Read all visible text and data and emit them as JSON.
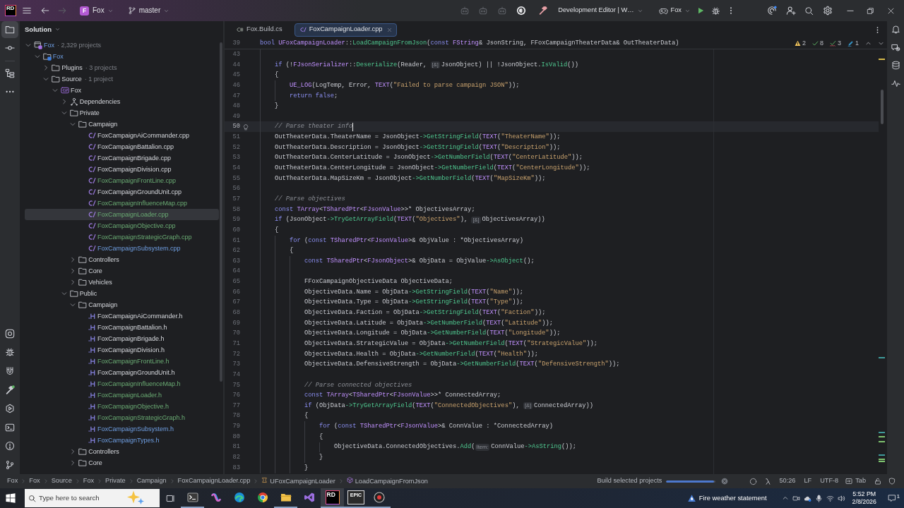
{
  "title_bar": {
    "logo": "RD",
    "project": {
      "initial": "F",
      "name": "Fox"
    },
    "branch": "master",
    "run_configuration": "Development Editor | W…",
    "target": "Fox",
    "history": {
      "back_disabled": false,
      "forward_disabled": true
    }
  },
  "tool_strip": {
    "top": [
      {
        "kind": "project",
        "selected": true
      },
      {
        "kind": "commit",
        "selected": false
      },
      {
        "kind": "structure",
        "selected": false
      },
      {
        "kind": "more",
        "selected": false
      }
    ],
    "bottom": [
      {
        "kind": "record",
        "selected": false
      },
      {
        "kind": "debug",
        "selected": false
      },
      {
        "kind": "magnet",
        "selected": false
      },
      {
        "kind": "build",
        "selected": false
      },
      {
        "kind": "run",
        "selected": false
      },
      {
        "kind": "terminal",
        "selected": false
      },
      {
        "kind": "problems",
        "selected": false
      },
      {
        "kind": "git",
        "selected": false
      }
    ]
  },
  "solution_panel": {
    "title": "Solution",
    "tree": [
      {
        "kind": "solution",
        "label": "Fox",
        "note": "· 2,329 projects",
        "added": false,
        "modified": true,
        "expanded": true,
        "selected": false,
        "children": [
          {
            "kind": "project",
            "label": "Fox",
            "added": false,
            "modified": true,
            "expanded": true,
            "selected": false,
            "children": [
              {
                "kind": "folder",
                "label": "Plugins",
                "note": "· 3 projects",
                "added": false,
                "modified": false,
                "expanded": false,
                "selected": false
              },
              {
                "kind": "folder",
                "label": "Source",
                "note": "· 1 project",
                "added": false,
                "modified": false,
                "expanded": true,
                "selected": false,
                "children": [
                  {
                    "kind": "module",
                    "label": "Fox",
                    "added": false,
                    "modified": false,
                    "expanded": true,
                    "selected": false,
                    "children": [
                      {
                        "kind": "dependencies",
                        "label": "Dependencies",
                        "added": false,
                        "modified": false,
                        "expanded": false,
                        "selected": false
                      },
                      {
                        "kind": "folder",
                        "label": "Private",
                        "added": false,
                        "modified": false,
                        "expanded": true,
                        "selected": false,
                        "children": [
                          {
                            "kind": "folder",
                            "label": "Campaign",
                            "added": false,
                            "modified": false,
                            "expanded": true,
                            "selected": false,
                            "children": [
                              {
                                "kind": "cpp-file",
                                "label": "FoxCampaignAiCommander.cpp",
                                "added": false,
                                "modified": false,
                                "selected": false
                              },
                              {
                                "kind": "cpp-file",
                                "label": "FoxCampaignBattalion.cpp",
                                "added": false,
                                "modified": false,
                                "selected": false
                              },
                              {
                                "kind": "cpp-file",
                                "label": "FoxCampaignBrigade.cpp",
                                "added": false,
                                "modified": false,
                                "selected": false
                              },
                              {
                                "kind": "cpp-file",
                                "label": "FoxCampaignDivision.cpp",
                                "added": false,
                                "modified": false,
                                "selected": false
                              },
                              {
                                "kind": "cpp-file",
                                "label": "FoxCampaignFrontLine.cpp",
                                "added": true,
                                "modified": false,
                                "selected": false
                              },
                              {
                                "kind": "cpp-file",
                                "label": "FoxCampaignGroundUnit.cpp",
                                "added": false,
                                "modified": false,
                                "selected": false
                              },
                              {
                                "kind": "cpp-file",
                                "label": "FoxCampaignInfluenceMap.cpp",
                                "added": true,
                                "modified": false,
                                "selected": false
                              },
                              {
                                "kind": "cpp-file",
                                "label": "FoxCampaignLoader.cpp",
                                "added": true,
                                "modified": false,
                                "selected": true
                              },
                              {
                                "kind": "cpp-file",
                                "label": "FoxCampaignObjective.cpp",
                                "added": true,
                                "modified": false,
                                "selected": false
                              },
                              {
                                "kind": "cpp-file",
                                "label": "FoxCampaignStrategicGraph.cpp",
                                "added": true,
                                "modified": false,
                                "selected": false
                              },
                              {
                                "kind": "cpp-file",
                                "label": "FoxCampaignSubsystem.cpp",
                                "added": false,
                                "modified": true,
                                "selected": false
                              }
                            ]
                          },
                          {
                            "kind": "folder",
                            "label": "Controllers",
                            "added": false,
                            "modified": false,
                            "expanded": false,
                            "selected": false
                          },
                          {
                            "kind": "folder",
                            "label": "Core",
                            "added": false,
                            "modified": false,
                            "expanded": false,
                            "selected": false
                          },
                          {
                            "kind": "folder",
                            "label": "Vehicles",
                            "added": false,
                            "modified": false,
                            "expanded": false,
                            "selected": false
                          }
                        ]
                      },
                      {
                        "kind": "folder",
                        "label": "Public",
                        "added": false,
                        "modified": false,
                        "expanded": true,
                        "selected": false,
                        "children": [
                          {
                            "kind": "folder",
                            "label": "Campaign",
                            "added": false,
                            "modified": false,
                            "expanded": true,
                            "selected": false,
                            "children": [
                              {
                                "kind": "header-file",
                                "label": "FoxCampaignAiCommander.h",
                                "added": false,
                                "modified": false,
                                "selected": false
                              },
                              {
                                "kind": "header-file",
                                "label": "FoxCampaignBattalion.h",
                                "added": false,
                                "modified": false,
                                "selected": false
                              },
                              {
                                "kind": "header-file",
                                "label": "FoxCampaignBrigade.h",
                                "added": false,
                                "modified": false,
                                "selected": false
                              },
                              {
                                "kind": "header-file",
                                "label": "FoxCampaignDivision.h",
                                "added": false,
                                "modified": false,
                                "selected": false
                              },
                              {
                                "kind": "header-file",
                                "label": "FoxCampaignFrontLine.h",
                                "added": true,
                                "modified": false,
                                "selected": false
                              },
                              {
                                "kind": "header-file",
                                "label": "FoxCampaignGroundUnit.h",
                                "added": false,
                                "modified": false,
                                "selected": false
                              },
                              {
                                "kind": "header-file",
                                "label": "FoxCampaignInfluenceMap.h",
                                "added": true,
                                "modified": false,
                                "selected": false
                              },
                              {
                                "kind": "header-file",
                                "label": "FoxCampaignLoader.h",
                                "added": true,
                                "modified": false,
                                "selected": false
                              },
                              {
                                "kind": "header-file",
                                "label": "FoxCampaignObjective.h",
                                "added": true,
                                "modified": false,
                                "selected": false
                              },
                              {
                                "kind": "header-file",
                                "label": "FoxCampaignStrategicGraph.h",
                                "added": true,
                                "modified": false,
                                "selected": false
                              },
                              {
                                "kind": "header-file",
                                "label": "FoxCampaignSubsystem.h",
                                "added": false,
                                "modified": true,
                                "selected": false
                              },
                              {
                                "kind": "header-file",
                                "label": "FoxCampaignTypes.h",
                                "added": false,
                                "modified": true,
                                "selected": false
                              }
                            ]
                          },
                          {
                            "kind": "folder",
                            "label": "Controllers",
                            "added": false,
                            "modified": false,
                            "expanded": false,
                            "selected": false
                          },
                          {
                            "kind": "folder",
                            "label": "Core",
                            "added": false,
                            "modified": false,
                            "expanded": false,
                            "selected": false
                          }
                        ]
                      }
                    ]
                  }
                ]
              }
            ]
          }
        ]
      }
    ]
  },
  "editor": {
    "tabs": [
      {
        "kind": "csharp",
        "label": "Fox.Build.cs",
        "selected": false
      },
      {
        "kind": "cpp",
        "label": "FoxCampaignLoader.cpp",
        "selected": true
      }
    ],
    "inspections": [
      {
        "kind": "warning",
        "count": "2"
      },
      {
        "kind": "check",
        "count": "8"
      },
      {
        "kind": "typo",
        "count": "3"
      },
      {
        "kind": "pencil",
        "count": "1"
      }
    ],
    "sticky_line": {
      "number": "39",
      "tokens": [
        {
          "kind": "keyword",
          "text": "bool "
        },
        {
          "kind": "type",
          "text": "UFoxCampaignLoader"
        },
        {
          "kind": "plain",
          "text": "::"
        },
        {
          "kind": "function",
          "text": "LoadCampaignFromJson"
        },
        {
          "kind": "plain",
          "text": "("
        },
        {
          "kind": "keyword",
          "text": "const "
        },
        {
          "kind": "type",
          "text": "FString"
        },
        {
          "kind": "plain",
          "text": "& JsonString, FFoxCampaignTheaterData& OutTheaterData)"
        }
      ]
    },
    "lines": [
      {
        "number": "43",
        "current": false
      },
      {
        "number": "44",
        "current": false,
        "tokens": [
          {
            "kind": "keyword",
            "text": "    if"
          },
          {
            "kind": "plain",
            "text": " (!"
          },
          {
            "kind": "type",
            "text": "FJsonSerializer"
          },
          {
            "kind": "plain",
            "text": "::"
          },
          {
            "kind": "function",
            "text": "Deserialize"
          },
          {
            "kind": "plain",
            "text": "(Reader, "
          },
          {
            "kind": "hint",
            "text": "[&]"
          },
          {
            "kind": "plain",
            "text": "JsonObject) || !JsonObject."
          },
          {
            "kind": "function",
            "text": "IsValid"
          },
          {
            "kind": "plain",
            "text": "())"
          }
        ]
      },
      {
        "number": "45",
        "current": false,
        "tokens": [
          {
            "kind": "plain",
            "text": "    {"
          }
        ]
      },
      {
        "number": "46",
        "current": false,
        "tokens": [
          {
            "kind": "type",
            "text": "        UE_LOG"
          },
          {
            "kind": "plain",
            "text": "(LogTemp, Error, "
          },
          {
            "kind": "type",
            "text": "TEXT"
          },
          {
            "kind": "plain",
            "text": "("
          },
          {
            "kind": "string",
            "text": "\"Failed to parse campaign JSON\""
          },
          {
            "kind": "plain",
            "text": "));"
          }
        ]
      },
      {
        "number": "47",
        "current": false,
        "tokens": [
          {
            "kind": "keyword",
            "text": "        return false"
          },
          {
            "kind": "plain",
            "text": ";"
          }
        ]
      },
      {
        "number": "48",
        "current": false,
        "tokens": [
          {
            "kind": "plain",
            "text": "    }"
          }
        ]
      },
      {
        "number": "49",
        "current": false
      },
      {
        "number": "50",
        "current": true,
        "tokens": [
          {
            "kind": "comment",
            "text": "    // Parse theater info"
          }
        ]
      },
      {
        "number": "51",
        "current": false,
        "tokens": [
          {
            "kind": "plain",
            "text": "    OutTheaterData.TheaterName = JsonObject"
          },
          {
            "kind": "function",
            "text": "->GetStringField"
          },
          {
            "kind": "plain",
            "text": "("
          },
          {
            "kind": "type",
            "text": "TEXT"
          },
          {
            "kind": "plain",
            "text": "("
          },
          {
            "kind": "string",
            "text": "\"TheaterName\""
          },
          {
            "kind": "plain",
            "text": "));"
          }
        ]
      },
      {
        "number": "52",
        "current": false,
        "tokens": [
          {
            "kind": "plain",
            "text": "    OutTheaterData.Description = JsonObject"
          },
          {
            "kind": "function",
            "text": "->GetStringField"
          },
          {
            "kind": "plain",
            "text": "("
          },
          {
            "kind": "type",
            "text": "TEXT"
          },
          {
            "kind": "plain",
            "text": "("
          },
          {
            "kind": "string",
            "text": "\"Description\""
          },
          {
            "kind": "plain",
            "text": "));"
          }
        ]
      },
      {
        "number": "53",
        "current": false,
        "tokens": [
          {
            "kind": "plain",
            "text": "    OutTheaterData.CenterLatitude = JsonObject"
          },
          {
            "kind": "function",
            "text": "->GetNumberField"
          },
          {
            "kind": "plain",
            "text": "("
          },
          {
            "kind": "type",
            "text": "TEXT"
          },
          {
            "kind": "plain",
            "text": "("
          },
          {
            "kind": "string",
            "text": "\"CenterLatitude\""
          },
          {
            "kind": "plain",
            "text": "));"
          }
        ]
      },
      {
        "number": "54",
        "current": false,
        "tokens": [
          {
            "kind": "plain",
            "text": "    OutTheaterData.CenterLongitude = JsonObject"
          },
          {
            "kind": "function",
            "text": "->GetNumberField"
          },
          {
            "kind": "plain",
            "text": "("
          },
          {
            "kind": "type",
            "text": "TEXT"
          },
          {
            "kind": "plain",
            "text": "("
          },
          {
            "kind": "string",
            "text": "\"CenterLongitude\""
          },
          {
            "kind": "plain",
            "text": "));"
          }
        ]
      },
      {
        "number": "55",
        "current": false,
        "tokens": [
          {
            "kind": "plain",
            "text": "    OutTheaterData.MapSizeKm = JsonObject"
          },
          {
            "kind": "function",
            "text": "->GetNumberField"
          },
          {
            "kind": "plain",
            "text": "("
          },
          {
            "kind": "type",
            "text": "TEXT"
          },
          {
            "kind": "plain",
            "text": "("
          },
          {
            "kind": "string",
            "text": "\"MapSizeKm\""
          },
          {
            "kind": "plain",
            "text": "));"
          }
        ]
      },
      {
        "number": "56",
        "current": false
      },
      {
        "number": "57",
        "current": false,
        "tokens": [
          {
            "kind": "comment",
            "text": "    // Parse objectives"
          }
        ]
      },
      {
        "number": "58",
        "current": false,
        "tokens": [
          {
            "kind": "keyword",
            "text": "    const "
          },
          {
            "kind": "type",
            "text": "TArray"
          },
          {
            "kind": "plain",
            "text": "<"
          },
          {
            "kind": "type",
            "text": "TSharedPtr"
          },
          {
            "kind": "plain",
            "text": "<"
          },
          {
            "kind": "type",
            "text": "FJsonValue"
          },
          {
            "kind": "plain",
            "text": ">>* ObjectivesArray;"
          }
        ]
      },
      {
        "number": "59",
        "current": false,
        "tokens": [
          {
            "kind": "keyword",
            "text": "    if"
          },
          {
            "kind": "plain",
            "text": " (JsonObject"
          },
          {
            "kind": "function",
            "text": "->TryGetArrayField"
          },
          {
            "kind": "plain",
            "text": "("
          },
          {
            "kind": "type",
            "text": "TEXT"
          },
          {
            "kind": "plain",
            "text": "("
          },
          {
            "kind": "string",
            "text": "\"Objectives\""
          },
          {
            "kind": "plain",
            "text": "), "
          },
          {
            "kind": "hint",
            "text": "[&]"
          },
          {
            "kind": "plain",
            "text": "ObjectivesArray))"
          }
        ]
      },
      {
        "number": "60",
        "current": false,
        "tokens": [
          {
            "kind": "plain",
            "text": "    {"
          }
        ]
      },
      {
        "number": "61",
        "current": false,
        "tokens": [
          {
            "kind": "keyword",
            "text": "        for"
          },
          {
            "kind": "plain",
            "text": " ("
          },
          {
            "kind": "keyword",
            "text": "const "
          },
          {
            "kind": "type",
            "text": "TSharedPtr"
          },
          {
            "kind": "plain",
            "text": "<"
          },
          {
            "kind": "type",
            "text": "FJsonValue"
          },
          {
            "kind": "plain",
            "text": ">& ObjValue : *ObjectivesArray)"
          }
        ]
      },
      {
        "number": "62",
        "current": false,
        "tokens": [
          {
            "kind": "plain",
            "text": "        {"
          }
        ]
      },
      {
        "number": "63",
        "current": false,
        "tokens": [
          {
            "kind": "keyword",
            "text": "            const "
          },
          {
            "kind": "type",
            "text": "TSharedPtr"
          },
          {
            "kind": "plain",
            "text": "<"
          },
          {
            "kind": "type",
            "text": "FJsonObject"
          },
          {
            "kind": "plain",
            "text": ">& ObjData = ObjValue"
          },
          {
            "kind": "function",
            "text": "->AsObject"
          },
          {
            "kind": "plain",
            "text": "();"
          }
        ]
      },
      {
        "number": "64",
        "current": false
      },
      {
        "number": "65",
        "current": false,
        "tokens": [
          {
            "kind": "plain",
            "text": "            FFoxCampaignObjectiveData ObjectiveData;"
          }
        ]
      },
      {
        "number": "66",
        "current": false,
        "tokens": [
          {
            "kind": "plain",
            "text": "            ObjectiveData.Name = ObjData"
          },
          {
            "kind": "function",
            "text": "->GetStringField"
          },
          {
            "kind": "plain",
            "text": "("
          },
          {
            "kind": "type",
            "text": "TEXT"
          },
          {
            "kind": "plain",
            "text": "("
          },
          {
            "kind": "string",
            "text": "\"Name\""
          },
          {
            "kind": "plain",
            "text": "));"
          }
        ]
      },
      {
        "number": "67",
        "current": false,
        "tokens": [
          {
            "kind": "plain",
            "text": "            ObjectiveData.Type = ObjData"
          },
          {
            "kind": "function",
            "text": "->GetStringField"
          },
          {
            "kind": "plain",
            "text": "("
          },
          {
            "kind": "type",
            "text": "TEXT"
          },
          {
            "kind": "plain",
            "text": "("
          },
          {
            "kind": "string",
            "text": "\"Type\""
          },
          {
            "kind": "plain",
            "text": "));"
          }
        ]
      },
      {
        "number": "68",
        "current": false,
        "tokens": [
          {
            "kind": "plain",
            "text": "            ObjectiveData.Faction = ObjData"
          },
          {
            "kind": "function",
            "text": "->GetStringField"
          },
          {
            "kind": "plain",
            "text": "("
          },
          {
            "kind": "type",
            "text": "TEXT"
          },
          {
            "kind": "plain",
            "text": "("
          },
          {
            "kind": "string",
            "text": "\"Faction\""
          },
          {
            "kind": "plain",
            "text": "));"
          }
        ]
      },
      {
        "number": "69",
        "current": false,
        "tokens": [
          {
            "kind": "plain",
            "text": "            ObjectiveData.Latitude = ObjData"
          },
          {
            "kind": "function",
            "text": "->GetNumberField"
          },
          {
            "kind": "plain",
            "text": "("
          },
          {
            "kind": "type",
            "text": "TEXT"
          },
          {
            "kind": "plain",
            "text": "("
          },
          {
            "kind": "string",
            "text": "\"Latitude\""
          },
          {
            "kind": "plain",
            "text": "));"
          }
        ]
      },
      {
        "number": "70",
        "current": false,
        "tokens": [
          {
            "kind": "plain",
            "text": "            ObjectiveData.Longitude = ObjData"
          },
          {
            "kind": "function",
            "text": "->GetNumberField"
          },
          {
            "kind": "plain",
            "text": "("
          },
          {
            "kind": "type",
            "text": "TEXT"
          },
          {
            "kind": "plain",
            "text": "("
          },
          {
            "kind": "string",
            "text": "\"Longitude\""
          },
          {
            "kind": "plain",
            "text": "));"
          }
        ]
      },
      {
        "number": "71",
        "current": false,
        "tokens": [
          {
            "kind": "plain",
            "text": "            ObjectiveData.StrategicValue = ObjData"
          },
          {
            "kind": "function",
            "text": "->GetNumberField"
          },
          {
            "kind": "plain",
            "text": "("
          },
          {
            "kind": "type",
            "text": "TEXT"
          },
          {
            "kind": "plain",
            "text": "("
          },
          {
            "kind": "string",
            "text": "\"StrategicValue\""
          },
          {
            "kind": "plain",
            "text": "));"
          }
        ]
      },
      {
        "number": "72",
        "current": false,
        "tokens": [
          {
            "kind": "plain",
            "text": "            ObjectiveData.Health = ObjData"
          },
          {
            "kind": "function",
            "text": "->GetNumberField"
          },
          {
            "kind": "plain",
            "text": "("
          },
          {
            "kind": "type",
            "text": "TEXT"
          },
          {
            "kind": "plain",
            "text": "("
          },
          {
            "kind": "string",
            "text": "\"Health\""
          },
          {
            "kind": "plain",
            "text": "));"
          }
        ]
      },
      {
        "number": "73",
        "current": false,
        "tokens": [
          {
            "kind": "plain",
            "text": "            ObjectiveData.DefensiveStrength = ObjData"
          },
          {
            "kind": "function",
            "text": "->GetNumberField"
          },
          {
            "kind": "plain",
            "text": "("
          },
          {
            "kind": "type",
            "text": "TEXT"
          },
          {
            "kind": "plain",
            "text": "("
          },
          {
            "kind": "string",
            "text": "\"DefensiveStrength\""
          },
          {
            "kind": "plain",
            "text": "));"
          }
        ]
      },
      {
        "number": "74",
        "current": false
      },
      {
        "number": "75",
        "current": false,
        "tokens": [
          {
            "kind": "comment",
            "text": "            // Parse connected objectives"
          }
        ]
      },
      {
        "number": "76",
        "current": false,
        "tokens": [
          {
            "kind": "keyword",
            "text": "            const "
          },
          {
            "kind": "type",
            "text": "TArray"
          },
          {
            "kind": "plain",
            "text": "<"
          },
          {
            "kind": "type",
            "text": "TSharedPtr"
          },
          {
            "kind": "plain",
            "text": "<"
          },
          {
            "kind": "type",
            "text": "FJsonValue"
          },
          {
            "kind": "plain",
            "text": ">>* ConnectedArray;"
          }
        ]
      },
      {
        "number": "77",
        "current": false,
        "tokens": [
          {
            "kind": "keyword",
            "text": "            if"
          },
          {
            "kind": "plain",
            "text": " (ObjData"
          },
          {
            "kind": "function",
            "text": "->TryGetArrayField"
          },
          {
            "kind": "plain",
            "text": "("
          },
          {
            "kind": "type",
            "text": "TEXT"
          },
          {
            "kind": "plain",
            "text": "("
          },
          {
            "kind": "string",
            "text": "\"ConnectedObjectives\""
          },
          {
            "kind": "plain",
            "text": "), "
          },
          {
            "kind": "hint",
            "text": "[&]"
          },
          {
            "kind": "plain",
            "text": "ConnectedArray))"
          }
        ]
      },
      {
        "number": "78",
        "current": false,
        "tokens": [
          {
            "kind": "plain",
            "text": "            {"
          }
        ]
      },
      {
        "number": "79",
        "current": false,
        "tokens": [
          {
            "kind": "keyword",
            "text": "                for"
          },
          {
            "kind": "plain",
            "text": " ("
          },
          {
            "kind": "keyword",
            "text": "const "
          },
          {
            "kind": "type",
            "text": "TSharedPtr"
          },
          {
            "kind": "plain",
            "text": "<"
          },
          {
            "kind": "type",
            "text": "FJsonValue"
          },
          {
            "kind": "plain",
            "text": ">& ConnValue : *ConnectedArray)"
          }
        ]
      },
      {
        "number": "80",
        "current": false,
        "tokens": [
          {
            "kind": "plain",
            "text": "                {"
          }
        ]
      },
      {
        "number": "81",
        "current": false,
        "tokens": [
          {
            "kind": "plain",
            "text": "                    ObjectiveData.ConnectedObjectives."
          },
          {
            "kind": "function",
            "text": "Add"
          },
          {
            "kind": "plain",
            "text": "("
          },
          {
            "kind": "hint",
            "text": "Item:"
          },
          {
            "kind": "plain",
            "text": "ConnValue"
          },
          {
            "kind": "function",
            "text": "->AsString"
          },
          {
            "kind": "plain",
            "text": "());"
          }
        ]
      },
      {
        "number": "82",
        "current": false,
        "tokens": [
          {
            "kind": "plain",
            "text": "                }"
          }
        ]
      },
      {
        "number": "83",
        "current": false,
        "tokens": [
          {
            "kind": "plain",
            "text": "            }"
          }
        ]
      }
    ]
  },
  "status_bar": {
    "breadcrumbs": [
      {
        "kind": "plain",
        "label": "Fox"
      },
      {
        "kind": "plain",
        "label": "Fox"
      },
      {
        "kind": "plain",
        "label": "Source"
      },
      {
        "kind": "plain",
        "label": "Fox"
      },
      {
        "kind": "plain",
        "label": "Private"
      },
      {
        "kind": "plain",
        "label": "Campaign"
      },
      {
        "kind": "plain",
        "label": "FoxCampaignLoader.cpp"
      },
      {
        "kind": "class",
        "label": "UFoxCampaignLoader"
      },
      {
        "kind": "method",
        "label": "LoadCampaignFromJson"
      }
    ],
    "task": {
      "label": "Build selected projects",
      "level": 0.97
    },
    "caret_position": "50:26",
    "line_separator": "LF",
    "encoding": "UTF-8",
    "indent": "Tab"
  },
  "taskbar": {
    "search": {
      "placeholder": "Type here to search"
    },
    "apps": [
      {
        "kind": "terminal",
        "running": true,
        "active": false
      },
      {
        "kind": "ribbon",
        "running": false,
        "active": false
      },
      {
        "kind": "wave",
        "running": false,
        "active": false
      },
      {
        "kind": "pinwheel",
        "running": false,
        "active": false
      },
      {
        "kind": "folder",
        "running": true,
        "active": false
      },
      {
        "kind": "infinity",
        "running": false,
        "active": false
      },
      {
        "kind": "tile",
        "logo": "RD",
        "running": true,
        "active": true
      },
      {
        "kind": "tile",
        "logo": "EPIC",
        "running": true,
        "active": false
      },
      {
        "kind": "circle",
        "running": true,
        "active": false
      }
    ],
    "weather": "Fire weather statement",
    "time": "5:52 PM",
    "date": "2/8/2026",
    "notification_count": "1"
  }
}
